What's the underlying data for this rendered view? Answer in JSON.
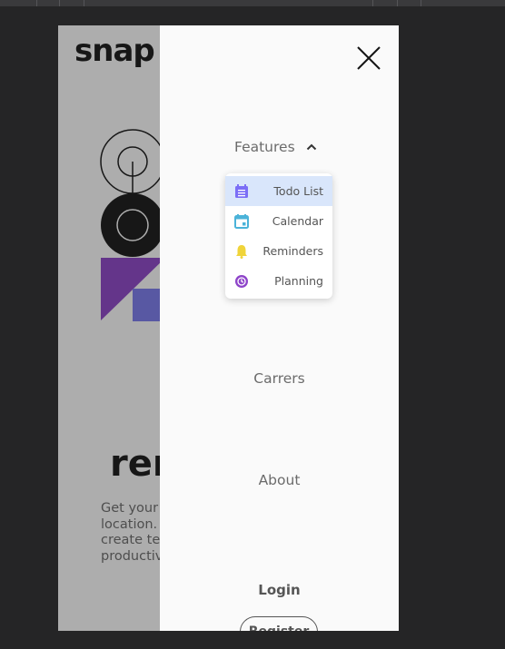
{
  "page": {
    "logo": "snap",
    "hero_heading": "rem",
    "hero_text_lines": [
      "Get your",
      "location.",
      "create te",
      "productiv"
    ]
  },
  "menu": {
    "features_label": "Features",
    "features_items": [
      {
        "label": "Todo List",
        "icon": "todo-list-icon",
        "color": "#7b6ef6"
      },
      {
        "label": "Calendar",
        "icon": "calendar-icon",
        "color": "#4bb3d9"
      },
      {
        "label": "Reminders",
        "icon": "bell-icon",
        "color": "#f0d43a"
      },
      {
        "label": "Planning",
        "icon": "planning-icon",
        "color": "#8e44c9"
      }
    ],
    "careers_label": "Carrers",
    "about_label": "About",
    "login_label": "Login",
    "register_label": "Register"
  },
  "colors": {
    "accent_purple": "#8e44c9",
    "accent_blue": "#7b7bf0",
    "active_item_bg": "#d9e6fb"
  }
}
